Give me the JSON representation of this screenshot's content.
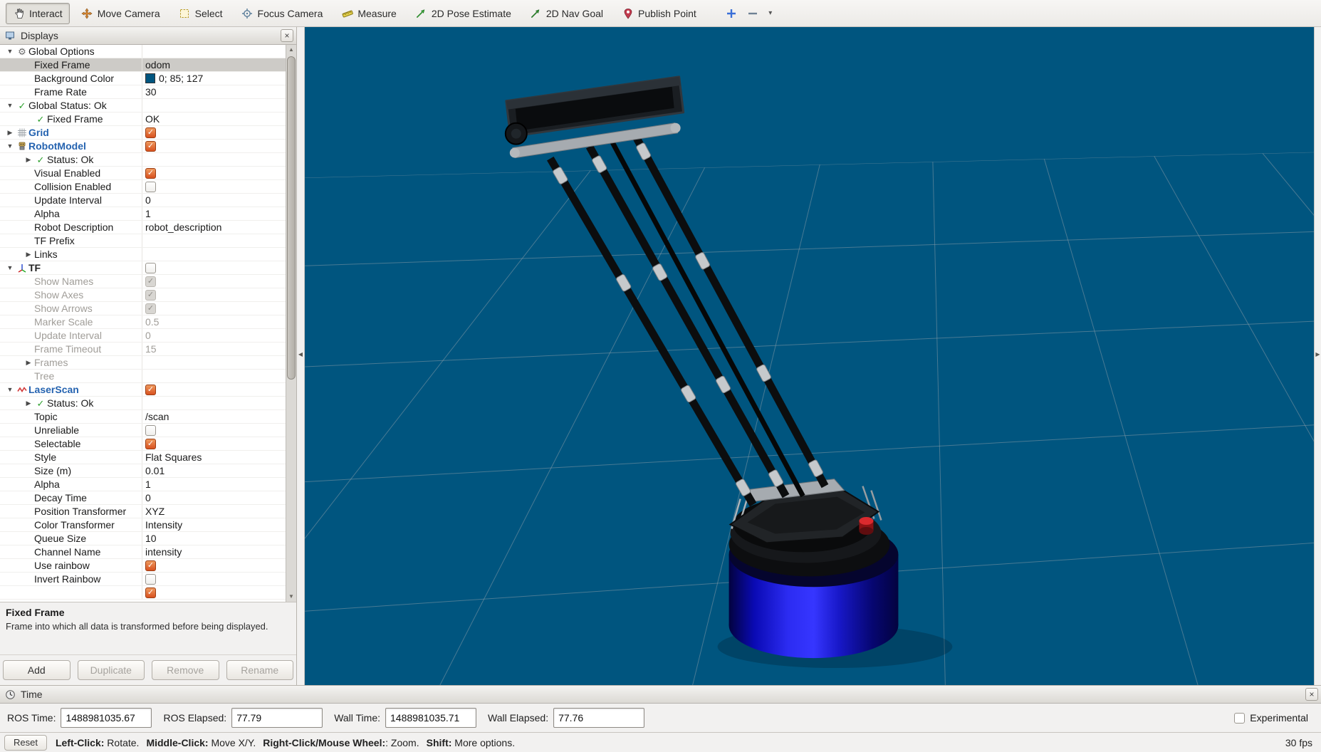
{
  "colors": {
    "viewport_bg": "#00557f",
    "panel_bg": "#f2f1f0",
    "accent_blue": "#2563b0",
    "check_orange": "#d8511f",
    "robot_base_blue": "#2c2cf2"
  },
  "toolbar": {
    "tools": [
      {
        "label": "Interact",
        "icon": "hand-cursor-icon",
        "active": true
      },
      {
        "label": "Move Camera",
        "icon": "move-camera-icon",
        "active": false
      },
      {
        "label": "Select",
        "icon": "selection-box-icon",
        "active": false
      },
      {
        "label": "Focus Camera",
        "icon": "focus-camera-icon",
        "active": false
      },
      {
        "label": "Measure",
        "icon": "measure-icon",
        "active": false
      },
      {
        "label": "2D Pose Estimate",
        "icon": "pose-arrow-icon",
        "active": false
      },
      {
        "label": "2D Nav Goal",
        "icon": "nav-goal-arrow-icon",
        "active": false
      },
      {
        "label": "Publish Point",
        "icon": "publish-point-icon",
        "active": false
      }
    ]
  },
  "displays_panel": {
    "title": "Displays",
    "rows": [
      {
        "indent": 0,
        "expander": "open",
        "icon": "gear-icon",
        "label": "Global Options",
        "value_type": "none"
      },
      {
        "indent": 1,
        "label": "Fixed Frame",
        "value": "odom",
        "value_type": "text",
        "selected": true
      },
      {
        "indent": 1,
        "label": "Background Color",
        "value": "0; 85; 127",
        "value_type": "color",
        "swatch": "#00557f"
      },
      {
        "indent": 1,
        "label": "Frame Rate",
        "value": "30",
        "value_type": "text"
      },
      {
        "indent": 0,
        "expander": "open",
        "icon": "check-icon",
        "label": "Global Status: Ok",
        "value_type": "none"
      },
      {
        "indent": 1,
        "icon": "check-icon",
        "label": "Fixed Frame",
        "value": "OK",
        "value_type": "text"
      },
      {
        "indent": 0,
        "expander": "closed",
        "icon": "grid-icon",
        "label": "Grid",
        "label_class": "display-on",
        "value_type": "check"
      },
      {
        "indent": 0,
        "expander": "open",
        "icon": "robot-icon",
        "label": "RobotModel",
        "label_class": "display-on",
        "value_type": "check"
      },
      {
        "indent": 1,
        "expander": "closed",
        "icon": "check-icon",
        "label": "Status: Ok",
        "value_type": "none"
      },
      {
        "indent": 1,
        "label": "Visual Enabled",
        "value_type": "check"
      },
      {
        "indent": 1,
        "label": "Collision Enabled",
        "value_type": "uncheck"
      },
      {
        "indent": 1,
        "label": "Update Interval",
        "value": "0",
        "value_type": "text"
      },
      {
        "indent": 1,
        "label": "Alpha",
        "value": "1",
        "value_type": "text"
      },
      {
        "indent": 1,
        "label": "Robot Description",
        "value": "robot_description",
        "value_type": "text"
      },
      {
        "indent": 1,
        "label": "TF Prefix",
        "value": "",
        "value_type": "text"
      },
      {
        "indent": 1,
        "expander": "closed",
        "label": "Links",
        "value_type": "none"
      },
      {
        "indent": 0,
        "expander": "open",
        "icon": "tf-icon",
        "label": "TF",
        "label_class": "display-off",
        "value_type": "uncheck"
      },
      {
        "indent": 1,
        "label": "Show Names",
        "value_type": "check-disabled",
        "disabled": true
      },
      {
        "indent": 1,
        "label": "Show Axes",
        "value_type": "check-disabled",
        "disabled": true
      },
      {
        "indent": 1,
        "label": "Show Arrows",
        "value_type": "check-disabled",
        "disabled": true
      },
      {
        "indent": 1,
        "label": "Marker Scale",
        "value": "0.5",
        "value_type": "text",
        "disabled": true
      },
      {
        "indent": 1,
        "label": "Update Interval",
        "value": "0",
        "value_type": "text",
        "disabled": true
      },
      {
        "indent": 1,
        "label": "Frame Timeout",
        "value": "15",
        "value_type": "text",
        "disabled": true
      },
      {
        "indent": 1,
        "expander": "closed",
        "label": "Frames",
        "value_type": "none",
        "disabled": true
      },
      {
        "indent": 1,
        "label": "Tree",
        "value_type": "none",
        "disabled": true
      },
      {
        "indent": 0,
        "expander": "open",
        "icon": "laserscan-icon",
        "label": "LaserScan",
        "label_class": "display-on",
        "value_type": "check"
      },
      {
        "indent": 1,
        "expander": "closed",
        "icon": "check-icon",
        "label": "Status: Ok",
        "value_type": "none"
      },
      {
        "indent": 1,
        "label": "Topic",
        "value": "/scan",
        "value_type": "text"
      },
      {
        "indent": 1,
        "label": "Unreliable",
        "value_type": "uncheck"
      },
      {
        "indent": 1,
        "label": "Selectable",
        "value_type": "check"
      },
      {
        "indent": 1,
        "label": "Style",
        "value": "Flat Squares",
        "value_type": "text"
      },
      {
        "indent": 1,
        "label": "Size (m)",
        "value": "0.01",
        "value_type": "text"
      },
      {
        "indent": 1,
        "label": "Alpha",
        "value": "1",
        "value_type": "text"
      },
      {
        "indent": 1,
        "label": "Decay Time",
        "value": "0",
        "value_type": "text"
      },
      {
        "indent": 1,
        "label": "Position Transformer",
        "value": "XYZ",
        "value_type": "text"
      },
      {
        "indent": 1,
        "label": "Color Transformer",
        "value": "Intensity",
        "value_type": "text"
      },
      {
        "indent": 1,
        "label": "Queue Size",
        "value": "10",
        "value_type": "text"
      },
      {
        "indent": 1,
        "label": "Channel Name",
        "value": "intensity",
        "value_type": "text"
      },
      {
        "indent": 1,
        "label": "Use rainbow",
        "value_type": "check"
      },
      {
        "indent": 1,
        "label": "Invert Rainbow",
        "value_type": "uncheck"
      },
      {
        "indent": 1,
        "label": "",
        "value_type": "check"
      }
    ],
    "help": {
      "title": "Fixed Frame",
      "body": "Frame into which all data is transformed before being displayed."
    },
    "buttons": [
      {
        "label": "Add",
        "enabled": true
      },
      {
        "label": "Duplicate",
        "enabled": false
      },
      {
        "label": "Remove",
        "enabled": false
      },
      {
        "label": "Rename",
        "enabled": false
      }
    ]
  },
  "time_panel": {
    "title": "Time",
    "fields": [
      {
        "label": "ROS Time:",
        "value": "1488981035.67"
      },
      {
        "label": "ROS Elapsed:",
        "value": "77.79"
      },
      {
        "label": "Wall Time:",
        "value": "1488981035.71"
      },
      {
        "label": "Wall Elapsed:",
        "value": "77.76"
      }
    ],
    "experimental_label": "Experimental"
  },
  "status_bar": {
    "reset_label": "Reset",
    "help_segments": [
      {
        "bold": "Left-Click:",
        "text": " Rotate."
      },
      {
        "bold": "Middle-Click:",
        "text": " Move X/Y."
      },
      {
        "bold": "Right-Click/Mouse Wheel:",
        "text": ": Zoom."
      },
      {
        "bold": "Shift:",
        "text": " More options."
      }
    ],
    "fps": "30 fps"
  }
}
